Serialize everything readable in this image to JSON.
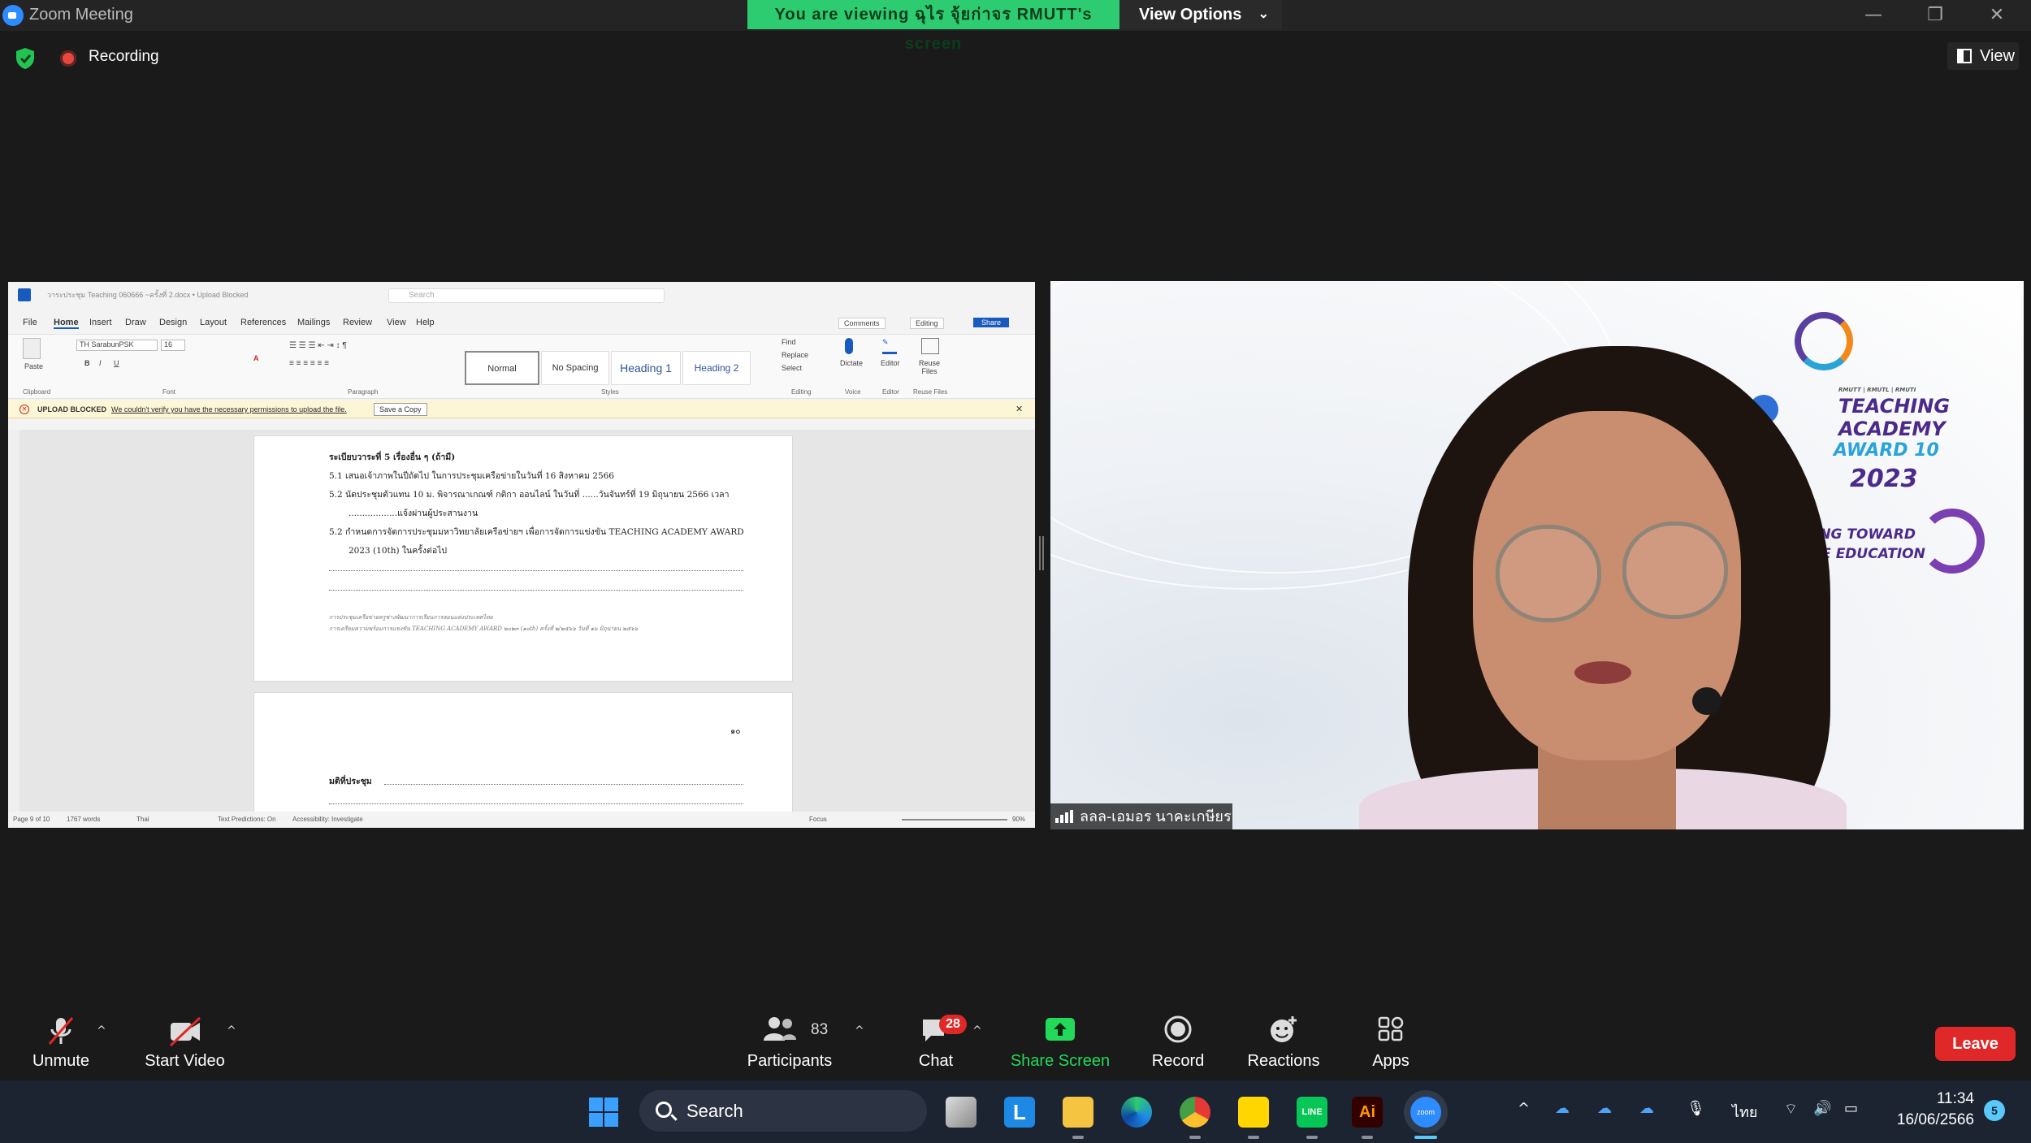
{
  "window": {
    "title": "Zoom Meeting",
    "controls": [
      "—",
      "❐",
      "✕"
    ]
  },
  "banner": {
    "viewing_text": "You are viewing ฉุไร จุ้ยก่าจร RMUTT's screen",
    "view_options_label": "View Options"
  },
  "meeting_status": {
    "recording_label": "Recording",
    "view_label": "View"
  },
  "word": {
    "doc_title": "วาระประชุม Teaching 060666 ~ครั้งที่ 2.docx • Upload Blocked",
    "search_placeholder": "Search",
    "menu": [
      "File",
      "Home",
      "Insert",
      "Draw",
      "Design",
      "Layout",
      "References",
      "Mailings",
      "Review",
      "View",
      "Help"
    ],
    "comments_label": "Comments",
    "editing_label": "Editing",
    "share_label": "Share",
    "font_name": "TH SarabunPSK",
    "font_size": "16",
    "styles": [
      "Normal",
      "No Spacing",
      "Heading 1",
      "Heading 2"
    ],
    "find_label": "Find",
    "replace_label": "Replace",
    "select_label": "Select",
    "dictate_label": "Dictate",
    "editor_label": "Editor",
    "reuse_label": "Reuse Files",
    "paste_label": "Paste",
    "group_labels": [
      "Clipboard",
      "Font",
      "Paragraph",
      "Styles",
      "Editing",
      "Voice",
      "Editor",
      "Reuse Files"
    ],
    "upload_blocked_title": "UPLOAD BLOCKED",
    "upload_blocked_msg": "We couldn't verify you have the necessary permissions to upload the file.",
    "save_copy_label": "Save a Copy",
    "page1_lines": [
      "ระเบียบวาระที่ 5 เรื่องอื่น ๆ (ถ้ามี)",
      "5.1 เสนอเจ้าภาพในปีถัดไป ในการประชุมเครือข่ายในวันที่ 16 สิงหาคม 2566",
      "5.2 นัดประชุมตัวแทน 10 ม. พิจารณาเกณฑ์ กติกา ออนไลน์ ในวันที่ ......วันจันทร์ที่ 19 มิถุนายน 2566 เวลา",
      "..................แจ้งผ่านผู้ประสานงาน",
      "5.2 กำหนดการจัดการประชุมมหาวิทยาลัยเครือข่ายฯ เพื่อการจัดการแข่งขัน TEACHING ACADEMY AWARD",
      "2023 (10th) ในครั้งต่อไป",
      "การประชุมเครือข่ายครูช่างพัฒนาการเรียนการสอนแห่งประเทศไทย",
      "การเตรียมความพร้อมการแข่งขัน TEACHING ACADEMY AWARD ๒๐๒๓ (๑๐th) ครั้งที่ ๒/๒๕๖๖ วันที่ ๑๖ มิถุนายน ๒๕๖๖"
    ],
    "page2_number": "๑๐",
    "page2_heading": "มติที่ประชุม",
    "status": {
      "page": "Page 9 of 10",
      "words": "1767 words",
      "language": "Thai",
      "predictions": "Text Predictions: On",
      "accessibility": "Accessibility: Investigate",
      "focus": "Focus",
      "zoom": "90%"
    }
  },
  "video": {
    "participant_name": "ลลล-เอมอร นาคะเกษียร",
    "logo_lines": [
      "RMUTT | RMUTL | RMUTI",
      "TEACHING",
      "ACADEMY",
      "AWARD 10",
      "2023",
      "ING TOWARD",
      "VE EDUCATION"
    ]
  },
  "toolbar": {
    "unmute": "Unmute",
    "start_video": "Start Video",
    "participants": "Participants",
    "participants_count": "83",
    "chat": "Chat",
    "chat_badge": "28",
    "share_screen": "Share Screen",
    "record": "Record",
    "reactions": "Reactions",
    "apps": "Apps",
    "leave": "Leave"
  },
  "taskbar": {
    "search_label": "Search",
    "language": "ไทย",
    "time": "11:34",
    "date": "16/06/2566",
    "notification_count": "5"
  },
  "colors": {
    "banner_green": "#2ecc71",
    "leave_red": "#e02828",
    "share_green": "#23d959",
    "zoom_blue": "#2d8cff",
    "word_blue": "#185abd"
  }
}
